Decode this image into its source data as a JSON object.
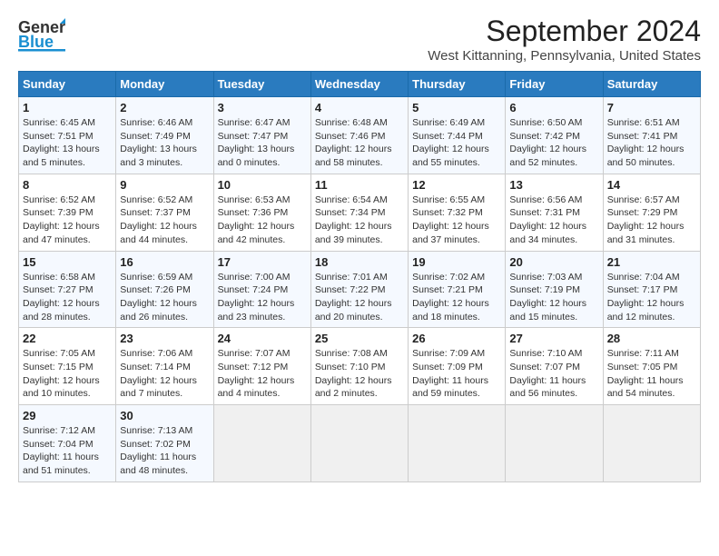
{
  "header": {
    "logo_general": "General",
    "logo_blue": "Blue",
    "title": "September 2024",
    "subtitle": "West Kittanning, Pennsylvania, United States"
  },
  "days_of_week": [
    "Sunday",
    "Monday",
    "Tuesday",
    "Wednesday",
    "Thursday",
    "Friday",
    "Saturday"
  ],
  "weeks": [
    [
      {
        "day": "1",
        "sunrise": "6:45 AM",
        "sunset": "7:51 PM",
        "daylight": "13 hours and 5 minutes."
      },
      {
        "day": "2",
        "sunrise": "6:46 AM",
        "sunset": "7:49 PM",
        "daylight": "13 hours and 3 minutes."
      },
      {
        "day": "3",
        "sunrise": "6:47 AM",
        "sunset": "7:47 PM",
        "daylight": "13 hours and 0 minutes."
      },
      {
        "day": "4",
        "sunrise": "6:48 AM",
        "sunset": "7:46 PM",
        "daylight": "12 hours and 58 minutes."
      },
      {
        "day": "5",
        "sunrise": "6:49 AM",
        "sunset": "7:44 PM",
        "daylight": "12 hours and 55 minutes."
      },
      {
        "day": "6",
        "sunrise": "6:50 AM",
        "sunset": "7:42 PM",
        "daylight": "12 hours and 52 minutes."
      },
      {
        "day": "7",
        "sunrise": "6:51 AM",
        "sunset": "7:41 PM",
        "daylight": "12 hours and 50 minutes."
      }
    ],
    [
      {
        "day": "8",
        "sunrise": "6:52 AM",
        "sunset": "7:39 PM",
        "daylight": "12 hours and 47 minutes."
      },
      {
        "day": "9",
        "sunrise": "6:52 AM",
        "sunset": "7:37 PM",
        "daylight": "12 hours and 44 minutes."
      },
      {
        "day": "10",
        "sunrise": "6:53 AM",
        "sunset": "7:36 PM",
        "daylight": "12 hours and 42 minutes."
      },
      {
        "day": "11",
        "sunrise": "6:54 AM",
        "sunset": "7:34 PM",
        "daylight": "12 hours and 39 minutes."
      },
      {
        "day": "12",
        "sunrise": "6:55 AM",
        "sunset": "7:32 PM",
        "daylight": "12 hours and 37 minutes."
      },
      {
        "day": "13",
        "sunrise": "6:56 AM",
        "sunset": "7:31 PM",
        "daylight": "12 hours and 34 minutes."
      },
      {
        "day": "14",
        "sunrise": "6:57 AM",
        "sunset": "7:29 PM",
        "daylight": "12 hours and 31 minutes."
      }
    ],
    [
      {
        "day": "15",
        "sunrise": "6:58 AM",
        "sunset": "7:27 PM",
        "daylight": "12 hours and 28 minutes."
      },
      {
        "day": "16",
        "sunrise": "6:59 AM",
        "sunset": "7:26 PM",
        "daylight": "12 hours and 26 minutes."
      },
      {
        "day": "17",
        "sunrise": "7:00 AM",
        "sunset": "7:24 PM",
        "daylight": "12 hours and 23 minutes."
      },
      {
        "day": "18",
        "sunrise": "7:01 AM",
        "sunset": "7:22 PM",
        "daylight": "12 hours and 20 minutes."
      },
      {
        "day": "19",
        "sunrise": "7:02 AM",
        "sunset": "7:21 PM",
        "daylight": "12 hours and 18 minutes."
      },
      {
        "day": "20",
        "sunrise": "7:03 AM",
        "sunset": "7:19 PM",
        "daylight": "12 hours and 15 minutes."
      },
      {
        "day": "21",
        "sunrise": "7:04 AM",
        "sunset": "7:17 PM",
        "daylight": "12 hours and 12 minutes."
      }
    ],
    [
      {
        "day": "22",
        "sunrise": "7:05 AM",
        "sunset": "7:15 PM",
        "daylight": "12 hours and 10 minutes."
      },
      {
        "day": "23",
        "sunrise": "7:06 AM",
        "sunset": "7:14 PM",
        "daylight": "12 hours and 7 minutes."
      },
      {
        "day": "24",
        "sunrise": "7:07 AM",
        "sunset": "7:12 PM",
        "daylight": "12 hours and 4 minutes."
      },
      {
        "day": "25",
        "sunrise": "7:08 AM",
        "sunset": "7:10 PM",
        "daylight": "12 hours and 2 minutes."
      },
      {
        "day": "26",
        "sunrise": "7:09 AM",
        "sunset": "7:09 PM",
        "daylight": "11 hours and 59 minutes."
      },
      {
        "day": "27",
        "sunrise": "7:10 AM",
        "sunset": "7:07 PM",
        "daylight": "11 hours and 56 minutes."
      },
      {
        "day": "28",
        "sunrise": "7:11 AM",
        "sunset": "7:05 PM",
        "daylight": "11 hours and 54 minutes."
      }
    ],
    [
      {
        "day": "29",
        "sunrise": "7:12 AM",
        "sunset": "7:04 PM",
        "daylight": "11 hours and 51 minutes."
      },
      {
        "day": "30",
        "sunrise": "7:13 AM",
        "sunset": "7:02 PM",
        "daylight": "11 hours and 48 minutes."
      },
      null,
      null,
      null,
      null,
      null
    ]
  ],
  "labels": {
    "sunrise": "Sunrise:",
    "sunset": "Sunset:",
    "daylight": "Daylight:"
  }
}
